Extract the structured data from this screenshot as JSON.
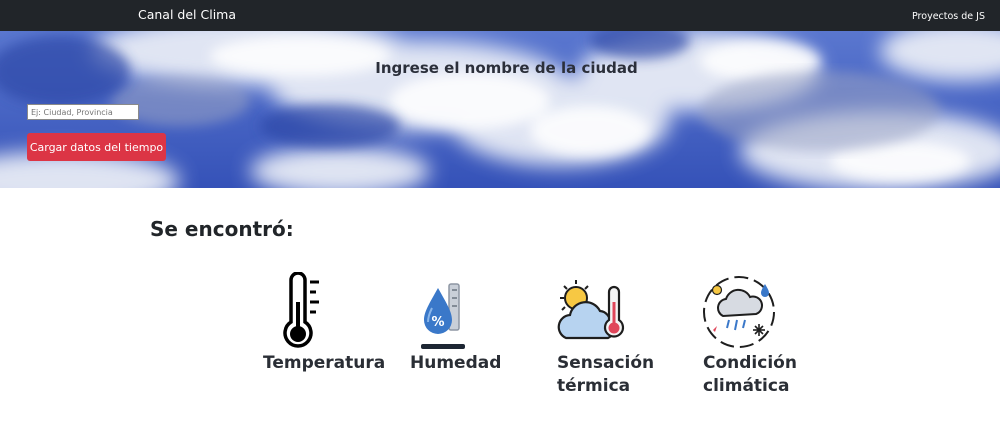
{
  "navbar": {
    "brand": "Canal del Clima",
    "link": "Proyectos de JS"
  },
  "hero": {
    "title": "Ingrese el nombre de la ciudad",
    "city_input_placeholder": "Ej: Ciudad, Provincia",
    "load_button_label": "Cargar datos del tiempo"
  },
  "results": {
    "heading": "Se encontró:",
    "items": [
      {
        "label": "Temperatura",
        "icon": "thermometer-icon"
      },
      {
        "label": "Humedad",
        "icon": "humidity-icon"
      },
      {
        "label": "Sensación térmica",
        "icon": "feels-like-icon"
      },
      {
        "label": "Condición climática",
        "icon": "weather-condition-icon"
      }
    ]
  },
  "colors": {
    "navbar_bg": "#212529",
    "button_bg": "#dc3545",
    "sky_blue": "#3f5fbf"
  }
}
